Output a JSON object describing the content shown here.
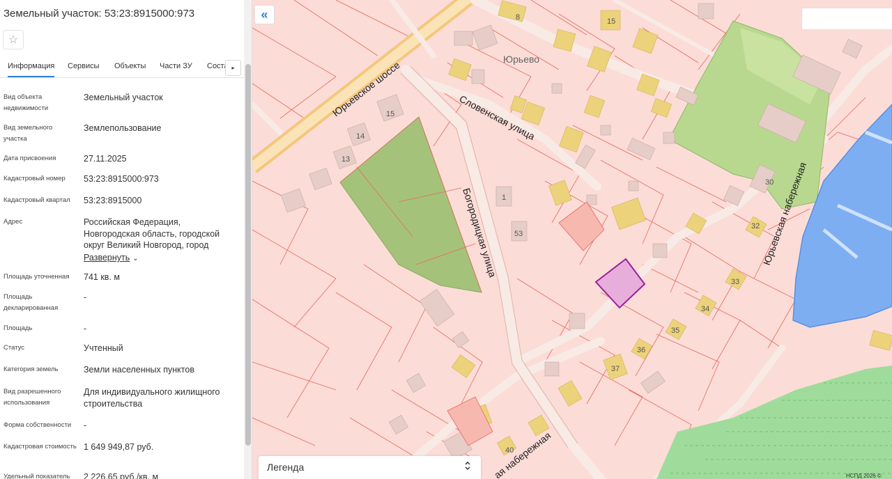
{
  "panel": {
    "title": "Земельный участок: 53:23:8915000:973",
    "star_icon": "☆",
    "tabs": [
      "Информация",
      "Сервисы",
      "Объекты",
      "Части ЗУ",
      "Состав"
    ],
    "next_tab_icon": "▸",
    "rows": [
      {
        "label": "Вид объекта недвижимости",
        "value": "Земельный участок"
      },
      {
        "label": "Вид земельного участка",
        "value": "Землепользование"
      },
      {
        "label": "Дата присвоения",
        "value": "27.11.2025"
      },
      {
        "label": "Кадастровый номер",
        "value": "53:23:8915000:973"
      },
      {
        "label": "Кадастровый квартал",
        "value": "53:23:8915000"
      },
      {
        "label": "Адрес",
        "value": "Российская Федерация, Новгородская область, городской округ Великий Новгород, город"
      },
      {
        "label": "Площадь уточненная",
        "value": "741 кв. м"
      },
      {
        "label": "Площадь декларированная",
        "value": "-"
      },
      {
        "label": "Площадь",
        "value": "-"
      },
      {
        "label": "Статус",
        "value": "Учтенный"
      },
      {
        "label": "Категория земель",
        "value": "Земли населенных пунктов"
      },
      {
        "label": "Вид разрешенного использования",
        "value": "Для индивидуального жилищного строительства"
      },
      {
        "label": "Форма собственности",
        "value": "-"
      },
      {
        "label": "Кадастровая стоимость",
        "value": "1 649 949,87 руб."
      },
      {
        "label": "Удельный показатель",
        "value": "2 226,65 руб./кв. м"
      }
    ],
    "expand_label": "Развернуть",
    "expand_icon": "⌄"
  },
  "map": {
    "collapse_icon": "«",
    "legend_title": "Легенда",
    "legend_toggle_icon": "⌃⌄",
    "copyright": "НСПД 2026 ©",
    "street_labels": {
      "yurievskoe": "Юрьевское шоссе",
      "slovenskaya": "Словенская улица",
      "bogoroditskaya": "Богородицкая улица",
      "yurievskaya_nab": "Юрьевская набережная",
      "nab_bottom": "ая набережная"
    },
    "place_label": "Юрьево",
    "house_numbers": [
      "8",
      "15",
      "15",
      "14",
      "13",
      "1",
      "53",
      "30",
      "32",
      "33",
      "34",
      "35",
      "36",
      "37",
      "40"
    ],
    "colors": {
      "parcel_fill": "#fbd9d4",
      "parcel_line": "#e8685e",
      "road": "#f9e9e2",
      "major_road": "#f7c97a",
      "building": "#e6cdc8",
      "building_yellow": "#ecd27a",
      "green": "#a2c27a",
      "water": "#7eaef2",
      "water_line": "#5a8fe0",
      "selected_fill": "#e8aedb",
      "selected_line": "#9a1f9a"
    }
  }
}
